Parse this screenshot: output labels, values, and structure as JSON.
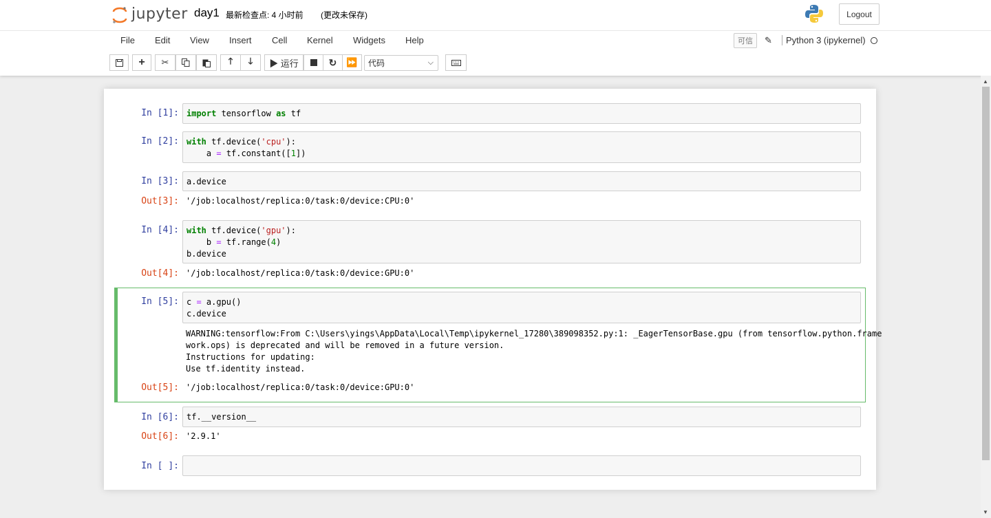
{
  "header": {
    "logo_text": "jupyter",
    "notebook_title": "day1",
    "checkpoint": "最新检查点: 4 小时前",
    "autosave": "(更改未保存)",
    "logout_label": "Logout"
  },
  "menubar": {
    "items": [
      "File",
      "Edit",
      "View",
      "Insert",
      "Cell",
      "Kernel",
      "Widgets",
      "Help"
    ],
    "trusted_label": "可信",
    "kernel_name": "Python 3 (ipykernel)"
  },
  "toolbar": {
    "run_label": "▶ 运行",
    "cell_type": "代码"
  },
  "cells": [
    {
      "in_prompt": "In  [1]:",
      "code": "import tensorflow as tf"
    },
    {
      "in_prompt": "In  [2]:",
      "code": "with tf.device('cpu'):\n    a = tf.constant([1])"
    },
    {
      "in_prompt": "In  [3]:",
      "code": "a.device",
      "out_prompt": "Out[3]:",
      "output": "'/job:localhost/replica:0/task:0/device:CPU:0'"
    },
    {
      "in_prompt": "In  [4]:",
      "code": "with tf.device('gpu'):\n    b = tf.range(4)\nb.device",
      "out_prompt": "Out[4]:",
      "output": "'/job:localhost/replica:0/task:0/device:GPU:0'"
    },
    {
      "in_prompt": "In  [5]:",
      "code": "c = a.gpu()\nc.device",
      "stderr": "WARNING:tensorflow:From C:\\Users\\yings\\AppData\\Local\\Temp\\ipykernel_17280\\389098352.py:1: _EagerTensorBase.gpu (from tensorflow.python.frame\nwork.ops) is deprecated and will be removed in a future version.\nInstructions for updating:\nUse tf.identity instead.",
      "out_prompt": "Out[5]:",
      "output": "'/job:localhost/replica:0/task:0/device:GPU:0'"
    },
    {
      "in_prompt": "In  [6]:",
      "code": "tf.__version__",
      "out_prompt": "Out[6]:",
      "output": "'2.9.1'"
    },
    {
      "in_prompt": "In  [ ]:",
      "code": ""
    }
  ]
}
